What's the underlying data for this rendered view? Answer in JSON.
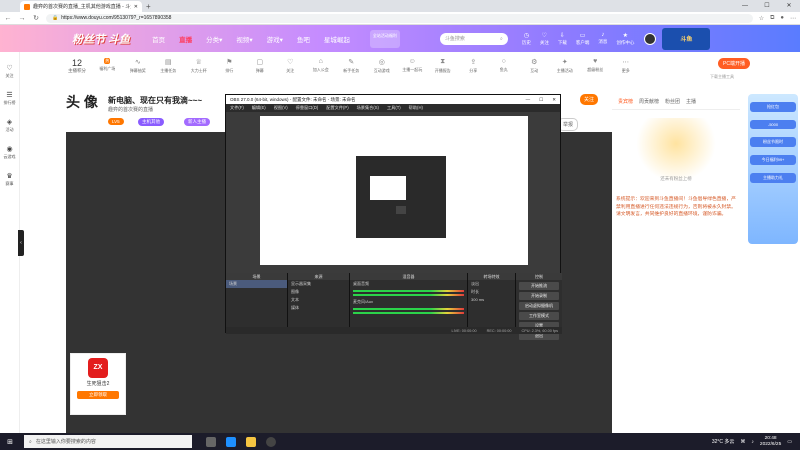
{
  "browser": {
    "tab_title": "趣弈的首次赛的直播_主机其他游戏直播 - 斗鱼直播",
    "new_tab": "+",
    "minimize": "—",
    "maximize": "☐",
    "close": "✕",
    "url": "https://www.douyu.com/9513079?_r=1657890358"
  },
  "site_header": {
    "logo": "粉丝节 斗鱼",
    "nav": [
      {
        "label": "首页"
      },
      {
        "label": "直播",
        "active": true
      },
      {
        "label": "分类▾"
      },
      {
        "label": "视频▾"
      },
      {
        "label": "游戏▾"
      },
      {
        "label": "鱼吧"
      },
      {
        "label": "星城崛起"
      }
    ],
    "promo": "全站活动福利",
    "search_placeholder": "斗鱼搜索",
    "icons": [
      {
        "icon": "history-icon",
        "label": "历史"
      },
      {
        "label": "关注",
        "icon": "heart-icon"
      },
      {
        "label": "下载",
        "icon": "download-icon"
      },
      {
        "label": "客户端",
        "icon": "monitor-icon"
      },
      {
        "label": "消息",
        "icon": "bell-icon"
      },
      {
        "label": "创作中心",
        "icon": "star-icon"
      }
    ],
    "banner": "斗鱼"
  },
  "left_sidebar": [
    {
      "label": "关注",
      "icon": "heart-icon"
    },
    {
      "label": "排行榜",
      "icon": "list-icon"
    },
    {
      "label": "活动",
      "icon": "gift-icon"
    },
    {
      "label": "云游戏",
      "icon": "gamepad-icon"
    },
    {
      "label": "赛事",
      "icon": "trophy-icon"
    }
  ],
  "toolbar": {
    "count_value": "12",
    "count_label": "主播积分",
    "hot_badge": "热",
    "items": [
      "福利广场",
      "弹幕抽奖",
      "主播任务",
      "大力士杯",
      "排行",
      "弹幕",
      "关注",
      "加入公会",
      "新手任务",
      "互动游戏",
      "主播一起玩",
      "开播报告",
      "分享",
      "鱼丸",
      "互动",
      "主播活动",
      "超级粉丝",
      "更多"
    ],
    "pc_button": "PC端开播",
    "pc_sub": "下载主播工具"
  },
  "room": {
    "avatar_text": "头 像",
    "title": "新电脑、现在只有我滴~~~",
    "streamer": "趣弈的首次赛的直播",
    "level_tag": "LV5",
    "pill_1": "主机其他",
    "pill_2": "新人主播",
    "pill_3": "关注",
    "report": "举报"
  },
  "chat": {
    "tabs": [
      "贵宾榜",
      "周贡献榜",
      "粉丝团",
      "主播"
    ],
    "mascot_caption": "还未有粉丝上榜",
    "notice": "系统提示：欢迎来到斗鱼直播间！斗鱼倡导绿色直播，严禁利用直播进行任何违法违规行为，否则将被永久封禁。请文明发言，共同维护良好的直播环境，谨防诈骗。"
  },
  "right_ad": {
    "title": "抢红包",
    "badge": "-5000",
    "lines": [
      "粉丝节限时",
      "今日福利99+",
      "主播助力礼"
    ]
  },
  "minigame": {
    "logo": "ZX",
    "title": "生死狙击2",
    "button": "立即领取"
  },
  "obs": {
    "title": "OBS 27.0.0 (64-bit, windows) - 配置文件: 未命名 - 场景: 未命名",
    "menu": [
      "文件(F)",
      "编辑(E)",
      "视图(V)",
      "停靠窗口(D)",
      "配置文件(P)",
      "场景集合(S)",
      "工具(T)",
      "帮助(H)"
    ],
    "docks": {
      "scenes_h": "场景",
      "scenes": [
        "场景"
      ],
      "sources_h": "来源",
      "sources": [
        "显示器采集",
        "图像",
        "文本",
        "媒体"
      ],
      "mixer_h": "混音器",
      "mixer_a": "桌面音频",
      "mixer_b": "麦克风/Aux",
      "trans_h": "转场特效",
      "trans_v": "淡出",
      "dur_label": "时长",
      "dur_value": "300 ms",
      "controls_h": "控制",
      "controls": [
        "开始推流",
        "开始录制",
        "启动虚拟摄像机",
        "工作室模式",
        "设置",
        "退出"
      ]
    },
    "status": [
      "LIVE: 00:00:00",
      "REC: 00:00:00",
      "CPU: 2.3%, 60.00 fps"
    ]
  },
  "taskbar": {
    "search": "在这里输入你要搜索的内容",
    "weather": "32°C 多云",
    "time": "20:48",
    "date": "2022/6/25"
  }
}
